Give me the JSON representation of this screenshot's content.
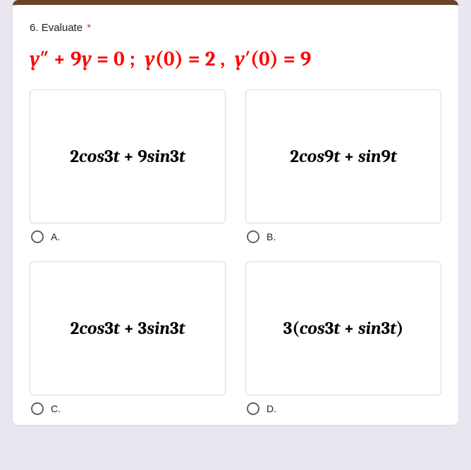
{
  "question": {
    "number": "6.",
    "prompt": "Evaluate",
    "required_marker": "*"
  },
  "equation_text": "y'' + 9y = 0 ;  y(0) = 2 ,  y'(0) = 9",
  "options": [
    {
      "id": "A",
      "label": "A.",
      "expr_text": "2cos3t + 9sin3t"
    },
    {
      "id": "B",
      "label": "B.",
      "expr_text": "2cos9t + sin9t"
    },
    {
      "id": "C",
      "label": "C.",
      "expr_text": "2cos3t + 3sin3t"
    },
    {
      "id": "D",
      "label": "D.",
      "expr_text": "3(cos3t + sin3t)"
    }
  ]
}
